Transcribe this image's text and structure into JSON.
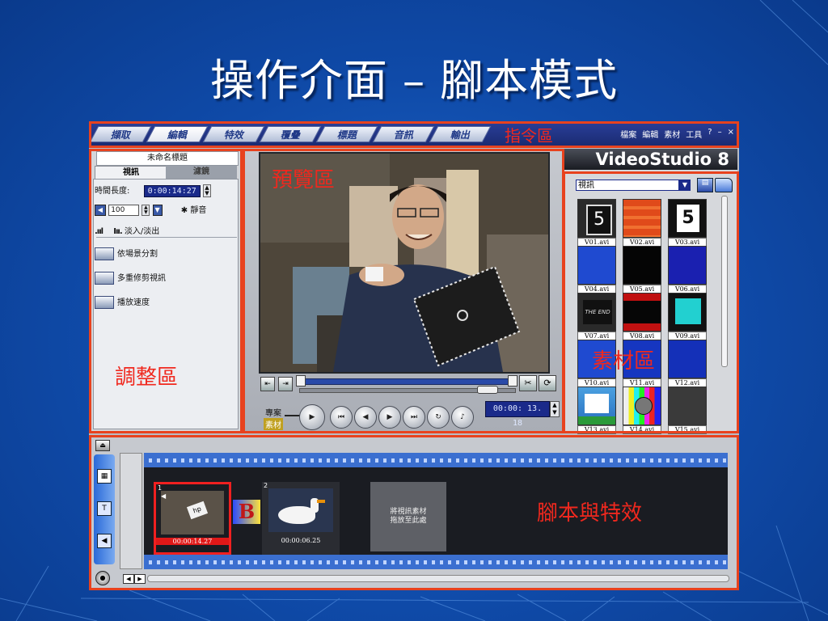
{
  "slide": {
    "title": "操作介面 – 腳本模式",
    "annotations": {
      "command_area": "指令區",
      "preview_area": "預覽區",
      "adjust_area": "調整區",
      "library_area": "素材區",
      "storyboard_area": "腳本與特效"
    }
  },
  "command_bar": {
    "tabs": [
      "擷取",
      "編輯",
      "特效",
      "覆疊",
      "標題",
      "音訊",
      "輸出"
    ],
    "active_tab": "編輯",
    "menus": [
      "檔案",
      "編輯",
      "素材",
      "工具",
      "?",
      "–",
      "×"
    ]
  },
  "adjust_panel": {
    "title": "未命名標題",
    "subtabs": [
      "視訊",
      "濾鏡"
    ],
    "duration_label": "時間長度:",
    "duration_value": "0:00:14:27",
    "volume_value": "100",
    "mute_label": "靜音",
    "fade_label": "淡入/淡出",
    "actions": [
      "依場景分割",
      "多重修剪視訊",
      "播放速度"
    ]
  },
  "preview": {
    "mode_project": "專案",
    "mode_clip": "素材",
    "timecode": "00:00: 13. 18"
  },
  "library": {
    "brand": "VideoStudio 8",
    "category": "視訊",
    "items": [
      "V01.avi",
      "V02.avi",
      "V03.avi",
      "V04.avi",
      "V05.avi",
      "V06.avi",
      "V07.avi",
      "V08.avi",
      "V09.avi",
      "V10.avi",
      "V11.avi",
      "V12.avi",
      "V13.avi",
      "V14.avi",
      "V15.avi"
    ],
    "thumb_texts": {
      "t1": "5",
      "t3": "5",
      "t7": "THE END"
    }
  },
  "storyboard": {
    "clips": [
      {
        "index": "1",
        "time": "00:00:14.27"
      },
      {
        "index": "2",
        "time": "00:00:06.25"
      }
    ],
    "transition_label": "B",
    "placeholder": "將視訊素材\n拖放至此處"
  },
  "colors": {
    "annotation_red": "#f0281e",
    "highlight_box": "#e8421e",
    "background": "#0f4aa8"
  }
}
